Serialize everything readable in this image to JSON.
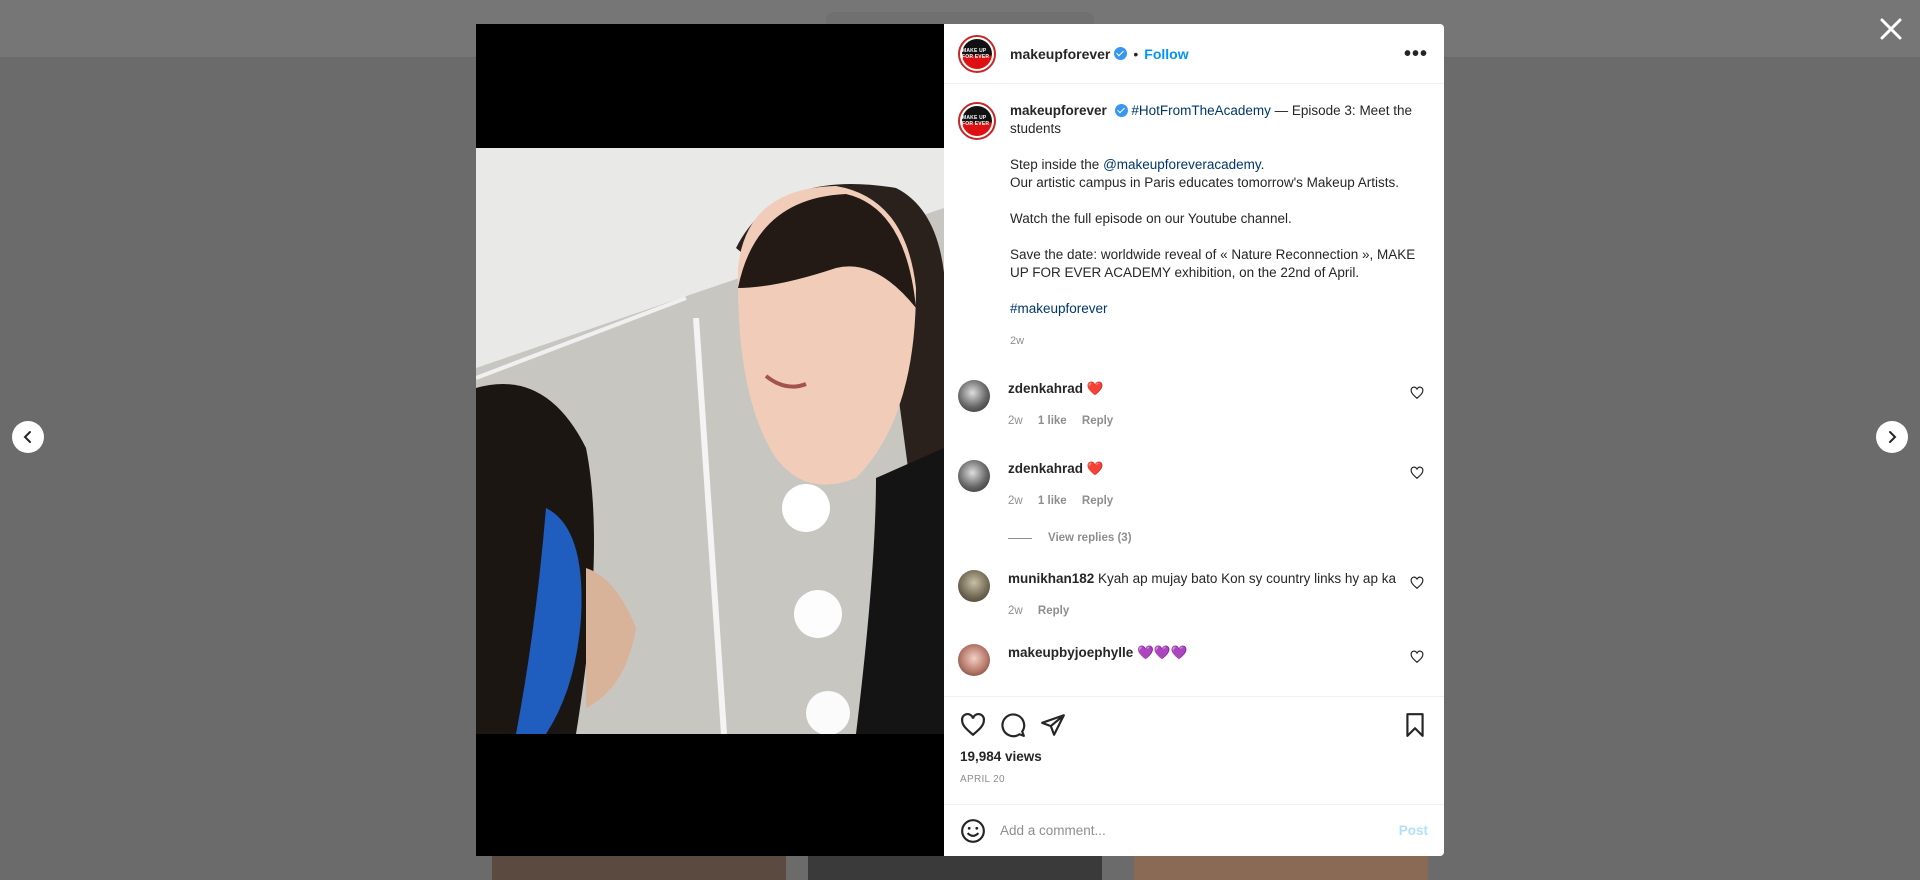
{
  "post": {
    "username": "makeupforever",
    "follow_label": "Follow",
    "dot": "•",
    "more": "•••",
    "brand_avatar_text": "MAKE UP FOR EVER",
    "caption": {
      "hashtag": "#HotFromTheAcademy",
      "title_rest": " — Episode 3: Meet the students",
      "step_prefix": "Step inside the ",
      "mention": "@makeupforeveracademy",
      "step_suffix": ".",
      "campus": "Our artistic campus in Paris educates tomorrow's Makeup Artists.",
      "watch": "Watch the full episode on our Youtube channel.",
      "save_date": "Save the date: worldwide reveal of « Nature Reconnection », MAKE UP FOR EVER ACADEMY exhibition, on the 22nd of April.",
      "tag": "#makeupforever",
      "age": "2w"
    }
  },
  "comments": [
    {
      "user": "zdenkahrad",
      "text": "❤️",
      "age": "2w",
      "likes": "1 like",
      "reply": "Reply"
    },
    {
      "user": "zdenkahrad",
      "text": "❤️",
      "age": "2w",
      "likes": "1 like",
      "reply": "Reply"
    },
    {
      "user": "munikhan182",
      "text": "Kyah ap mujay bato Kon sy country links hy ap ka",
      "age": "2w",
      "reply": "Reply"
    },
    {
      "user": "makeupbyjoephylle",
      "text": "💜💜💜"
    }
  ],
  "view_replies": "View replies (3)",
  "stats": {
    "views": "19,984 views",
    "date": "APRIL 20"
  },
  "add_comment": {
    "placeholder": "Add a comment...",
    "post_label": "Post"
  },
  "icons": {
    "close": "close-icon",
    "prev": "chevron-left-icon",
    "next": "chevron-right-icon",
    "like": "heart-icon",
    "comment": "comment-icon",
    "share": "share-icon",
    "save": "bookmark-icon",
    "emoji": "emoji-icon"
  },
  "colors": {
    "link": "#00376b",
    "follow": "#0095f6",
    "verified": "#3897f0",
    "post_disabled": "#b2dffc"
  }
}
